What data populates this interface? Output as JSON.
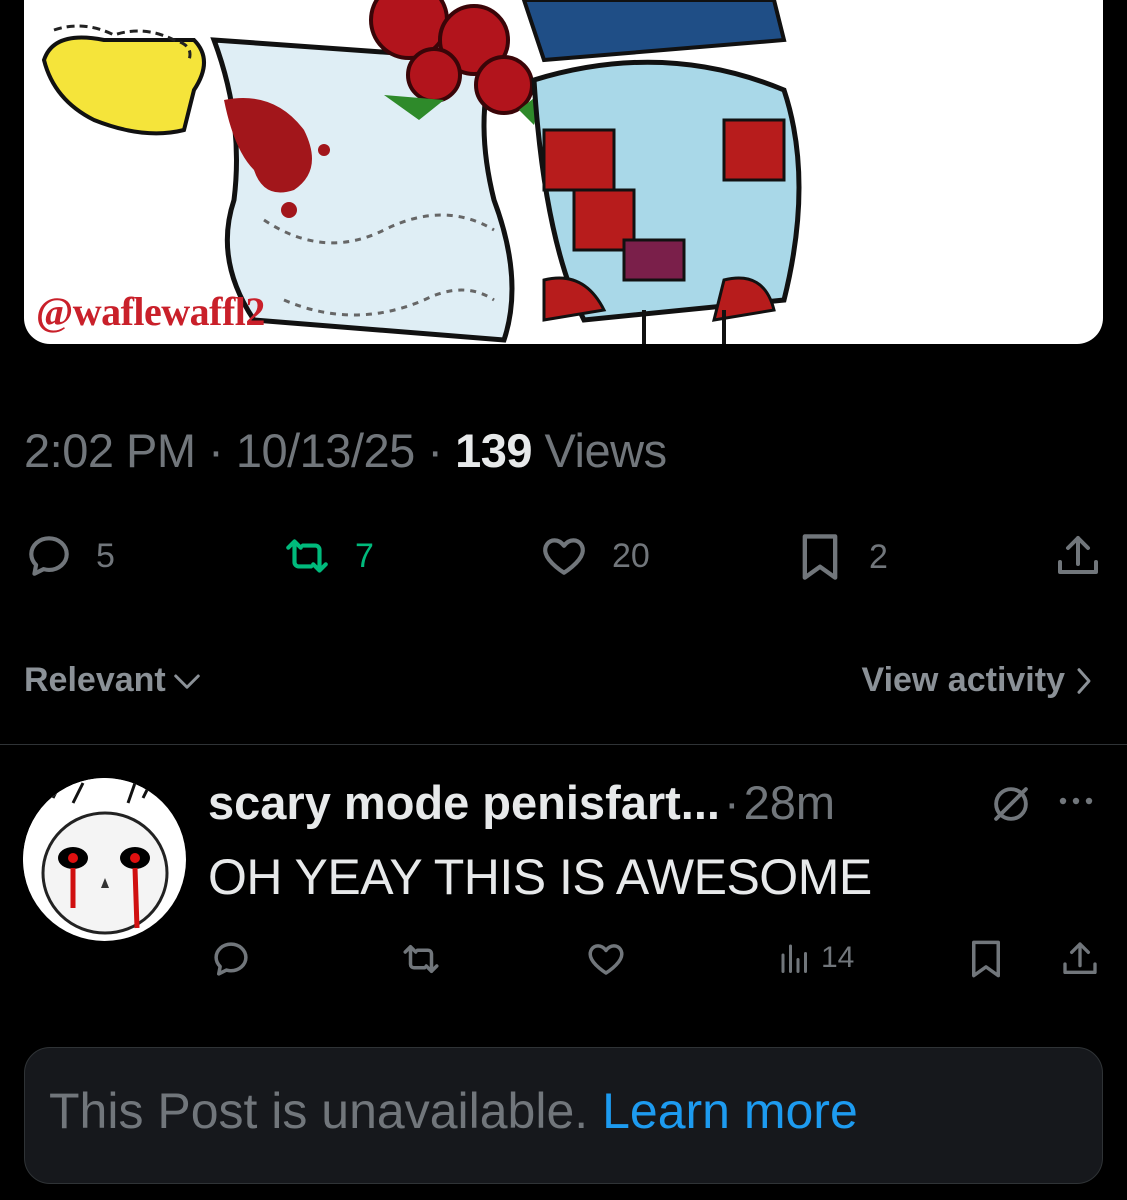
{
  "post": {
    "media": {
      "watermark": "@waflewaffl2"
    },
    "meta": {
      "time": "2:02 PM",
      "separator": "·",
      "date": "10/13/25",
      "views_count": "139",
      "views_label": "Views"
    },
    "actions": {
      "replies": "5",
      "reposts": "7",
      "likes": "20",
      "bookmarks": "2"
    }
  },
  "replies_bar": {
    "sort_label": "Relevant",
    "view_activity_label": "View activity"
  },
  "reply": {
    "author_name": "scary mode penisfart...",
    "separator": "·",
    "time": "28m",
    "text": "OH YEAY THIS IS AWESOME",
    "views": "14"
  },
  "unavailable": {
    "text": "This Post is unavailable.",
    "link": "Learn more"
  },
  "colors": {
    "background": "#000000",
    "primary_text": "#e7e9ea",
    "secondary_text": "#71767b",
    "repost_active": "#00ba7c",
    "link": "#1d9bf0"
  },
  "icons": [
    "reply-icon",
    "repost-icon",
    "like-icon",
    "bookmark-icon",
    "share-icon",
    "chevron-down-icon",
    "chevron-right-icon",
    "grok-icon",
    "more-icon",
    "views-icon"
  ]
}
